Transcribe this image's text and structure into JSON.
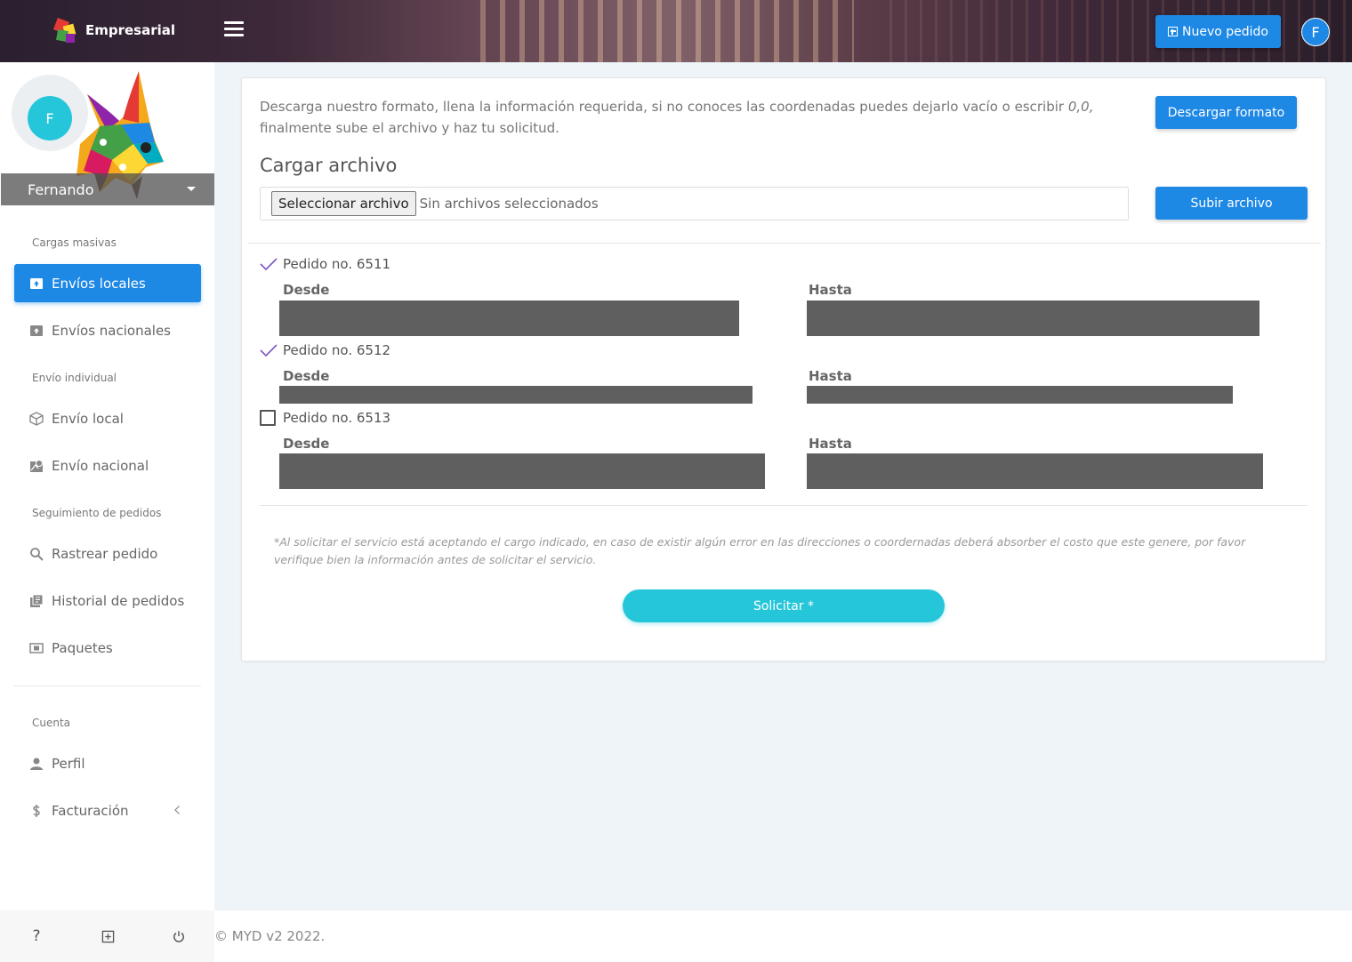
{
  "header": {
    "brand": "Empresarial",
    "new_order_label": "Nuevo pedido",
    "avatar_initial": "F"
  },
  "sidebar": {
    "avatar_initial": "F",
    "user_name": "Fernando",
    "sections": {
      "cargas": "Cargas masivas",
      "individual": "Envío individual",
      "seguimiento": "Seguimiento de pedidos",
      "cuenta": "Cuenta"
    },
    "items": {
      "envios_locales": "Envíos locales",
      "envios_nacionales": "Envíos nacionales",
      "envio_local": "Envío local",
      "envio_nacional": "Envío nacional",
      "rastrear": "Rastrear pedido",
      "historial": "Historial de pedidos",
      "paquetes": "Paquetes",
      "perfil": "Perfil",
      "facturacion": "Facturación"
    },
    "footer": {
      "help": "?"
    }
  },
  "main": {
    "intro_text": "Descarga nuestro formato, llena la información requerida, si no conoces las coordenadas puedes dejarlo vacío o escribir",
    "intro_coords": "0,0,",
    "intro_tail": "finalmente sube el archivo y haz tu solicitud.",
    "download_label": "Descargar formato",
    "upload_title": "Cargar archivo",
    "file_button": "Seleccionar archivo",
    "file_status": "Sin archivos seleccionados",
    "upload_label": "Subir archivo",
    "orders": [
      {
        "title": "Pedido no. 6511",
        "from_label": "Desde",
        "to_label": "Hasta",
        "checked": true
      },
      {
        "title": "Pedido no. 6512",
        "from_label": "Desde",
        "to_label": "Hasta",
        "checked": true
      },
      {
        "title": "Pedido no. 6513",
        "from_label": "Desde",
        "to_label": "Hasta",
        "checked": false
      }
    ],
    "disclaimer": "*Al solicitar el servicio está aceptando el cargo indicado, en caso de existir algún error en las direcciones o coordernadas deberá absorber el costo que este genere, por favor verifique bien la información antes de solicitar el servicio.",
    "submit_label": "Solicitar *"
  },
  "footer": {
    "copyright": "© MYD v2 2022."
  },
  "colors": {
    "primary": "#1e88e5",
    "cyan": "#26c6da",
    "check": "#7e57c2",
    "redacted": "#5f5f5f"
  }
}
